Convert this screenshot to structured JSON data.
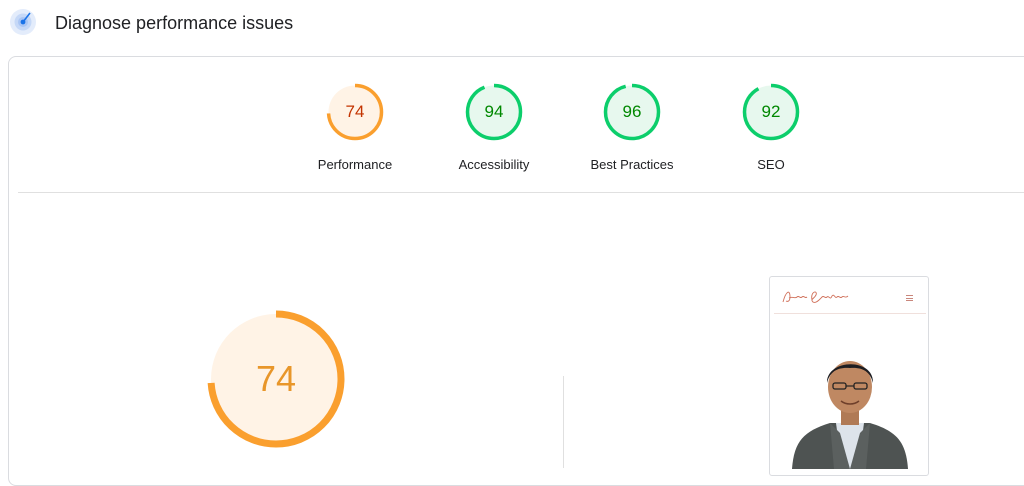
{
  "header": {
    "title": "Diagnose performance issues",
    "icon": "lighthouse-pulse-icon"
  },
  "scores": [
    {
      "label": "Performance",
      "value": "74",
      "level": 0.74,
      "color": "#fa9f2e",
      "text_color": "#c33300",
      "fill": "#fff3e6"
    },
    {
      "label": "Accessibility",
      "value": "94",
      "level": 0.94,
      "color": "#0cce6b",
      "text_color": "#008800",
      "fill": "#e7f8ee"
    },
    {
      "label": "Best Practices",
      "value": "96",
      "level": 0.96,
      "color": "#0cce6b",
      "text_color": "#008800",
      "fill": "#e7f8ee"
    },
    {
      "label": "SEO",
      "value": "92",
      "level": 0.92,
      "color": "#0cce6b",
      "text_color": "#008800",
      "fill": "#e7f8ee"
    }
  ],
  "performance_detail": {
    "value": "74",
    "level": 0.74,
    "color": "#fa9f2e",
    "fill": "#fff3e6"
  },
  "screenshot": {
    "logo_text": "Anam Sinapan",
    "menu_icon": "hamburger-menu-icon",
    "photo": "person-portrait"
  }
}
